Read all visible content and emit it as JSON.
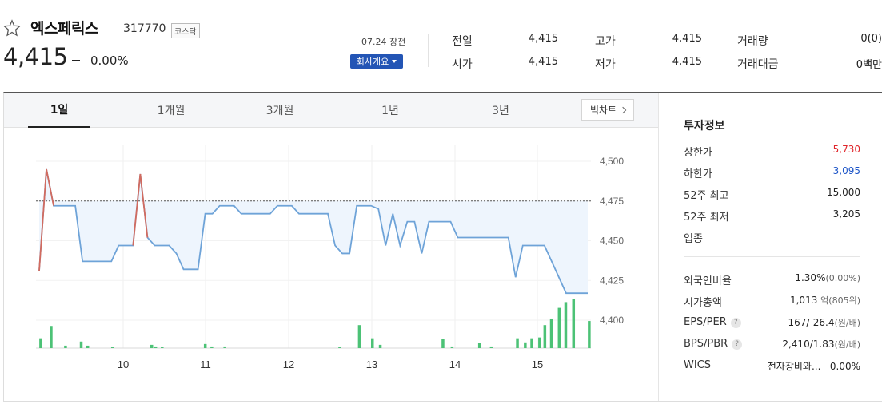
{
  "header": {
    "stock_name": "엑스페릭스",
    "stock_code": "317770",
    "market": "코스닥",
    "price": "4,415",
    "change_rate": "0.00%",
    "date_status": "07.24 장전",
    "company_button": "회사개요",
    "stats": [
      {
        "label": "전일",
        "value": "4,415"
      },
      {
        "label": "시가",
        "value": "4,415"
      },
      {
        "label": "고가",
        "value": "4,415"
      },
      {
        "label": "저가",
        "value": "4,415"
      },
      {
        "label": "거래량",
        "value": "0(0)"
      },
      {
        "label": "거래대금",
        "value": "0백만"
      }
    ]
  },
  "tabs": [
    "1일",
    "1개월",
    "3개월",
    "1년",
    "3년"
  ],
  "active_tab": "1일",
  "candle_button": "빅차트",
  "chart_data": {
    "type": "line",
    "x_ticks": [
      "10",
      "11",
      "12",
      "13",
      "14",
      "15"
    ],
    "y_ticks": [
      "4,500",
      "4,475",
      "4,450",
      "4,425",
      "4,400"
    ],
    "ylim": [
      4400,
      4500
    ],
    "reference_price": 4475,
    "price_series": [
      4431,
      4495,
      4472,
      4472,
      4472,
      4472,
      4437,
      4437,
      4437,
      4437,
      4437,
      4447,
      4447,
      4447,
      4492,
      4452,
      4447,
      4447,
      4447,
      4442,
      4432,
      4432,
      4432,
      4467,
      4467,
      4472,
      4472,
      4472,
      4467,
      4467,
      4467,
      4467,
      4467,
      4472,
      4472,
      4472,
      4467,
      4467,
      4467,
      4467,
      4467,
      4447,
      4442,
      4442,
      4472,
      4472,
      4472,
      4470,
      4447,
      4467,
      4447,
      4462,
      4462,
      4442,
      4462,
      4462,
      4462,
      4462,
      4452,
      4452,
      4452,
      4452,
      4452,
      4452,
      4452,
      4452,
      4427,
      4447,
      4447,
      4447,
      4447,
      4437,
      4427,
      4417,
      4417,
      4417,
      4417
    ],
    "volume_series": [
      0,
      0,
      3,
      0,
      7,
      0,
      0,
      0,
      1,
      0,
      0,
      0,
      0,
      0,
      0,
      0,
      0,
      0,
      0,
      0,
      0,
      0,
      0,
      0,
      0,
      0,
      0,
      0,
      0,
      0,
      0,
      0,
      0,
      0,
      0,
      0,
      0,
      0,
      0,
      0,
      0,
      0,
      0,
      0,
      0,
      0,
      0,
      0,
      0,
      0,
      0,
      0,
      0,
      0,
      0,
      0,
      0,
      0,
      0,
      0,
      0,
      0,
      0,
      0,
      0,
      0,
      0,
      0,
      0,
      0,
      0,
      0,
      0,
      0,
      0,
      0,
      0
    ],
    "volume_bars": [
      {
        "x": 0.1,
        "v": 12
      },
      {
        "x": 0.9,
        "v": 27
      },
      {
        "x": 2.0,
        "v": 3
      },
      {
        "x": 3.2,
        "v": 8
      },
      {
        "x": 3.7,
        "v": 3
      },
      {
        "x": 5.6,
        "v": 1
      },
      {
        "x": 8.6,
        "v": 4
      },
      {
        "x": 8.9,
        "v": 2
      },
      {
        "x": 9.4,
        "v": 1
      },
      {
        "x": 12.7,
        "v": 5
      },
      {
        "x": 13.2,
        "v": 2
      },
      {
        "x": 14.2,
        "v": 2
      },
      {
        "x": 23.0,
        "v": 1
      },
      {
        "x": 24.5,
        "v": 28
      },
      {
        "x": 25.5,
        "v": 12
      },
      {
        "x": 26.1,
        "v": 4
      },
      {
        "x": 30.9,
        "v": 11
      },
      {
        "x": 31.6,
        "v": 2
      },
      {
        "x": 33.7,
        "v": 6
      },
      {
        "x": 34.6,
        "v": 2
      },
      {
        "x": 36.6,
        "v": 12
      },
      {
        "x": 37.2,
        "v": 7
      },
      {
        "x": 37.7,
        "v": 12
      },
      {
        "x": 38.3,
        "v": 13
      },
      {
        "x": 38.7,
        "v": 28
      },
      {
        "x": 39.2,
        "v": 36
      },
      {
        "x": 39.8,
        "v": 49
      },
      {
        "x": 40.3,
        "v": 56
      },
      {
        "x": 40.9,
        "v": 60
      },
      {
        "x": 42.1,
        "v": 33
      }
    ],
    "colors": {
      "line": "#6ea3d8",
      "high_line": "#d26b5f",
      "fill": "#eef5fd",
      "volume": "#4cc276",
      "ref_line": "#555555"
    }
  },
  "invest_info": {
    "title": "투자정보",
    "rows": [
      {
        "label": "상한가",
        "value": "5,730",
        "tone": "up"
      },
      {
        "label": "하한가",
        "value": "3,095",
        "tone": "down"
      },
      {
        "label": "52주 최고",
        "value": "15,000",
        "tone": ""
      },
      {
        "label": "52주 최저",
        "value": "3,205",
        "tone": ""
      },
      {
        "label": "업종",
        "value": "",
        "tone": ""
      }
    ],
    "rows2": [
      {
        "label": "외국인비율",
        "value": "1.30%",
        "unit": "(0.00%)",
        "help": false
      },
      {
        "label": "시가총액",
        "value": "1,013",
        "unit": "억(805위)",
        "help": false
      },
      {
        "label": "EPS/PER",
        "value": "-167/-26.4",
        "unit": "(원/배)",
        "help": true
      },
      {
        "label": "BPS/PBR",
        "value": "2,410/1.83",
        "unit": "(원/배)",
        "help": true
      },
      {
        "label": "WICS",
        "value": "전자장비와...",
        "unit": "0.00%",
        "help": false
      }
    ]
  }
}
